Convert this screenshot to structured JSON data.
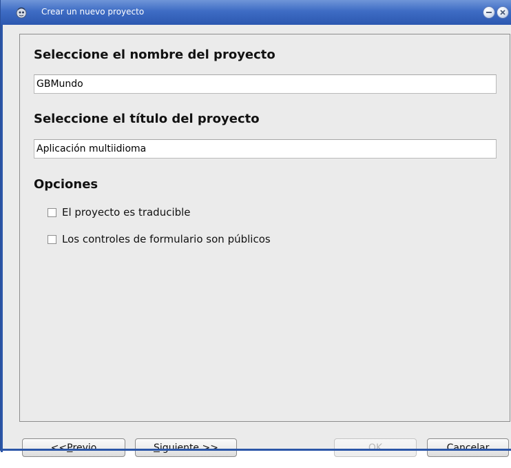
{
  "window": {
    "title": "Crear un nuevo proyecto",
    "icon": "gambas-app-icon",
    "controls": [
      "minimize-icon",
      "close-icon"
    ]
  },
  "form": {
    "name_heading": "Seleccione el nombre del proyecto",
    "name_value": "GBMundo",
    "title_heading": "Seleccione el título del proyecto",
    "title_value": "Aplicación multiidioma",
    "options_heading": "Opciones",
    "options": [
      {
        "label": "El proyecto es traducible",
        "checked": false
      },
      {
        "label": "Los controles de formulario son públicos",
        "checked": false
      }
    ]
  },
  "buttons": {
    "prev_pre": "<< ",
    "prev_mnemonic": "P",
    "prev_post": "revio",
    "next_mnemonic": "S",
    "next_post": "iguiente >>",
    "ok": "OK",
    "ok_enabled": false,
    "cancel": "Cancelar"
  },
  "colors": {
    "titlebar": "#3e6cc4",
    "dialog_bg": "#ebebeb",
    "disabled_text": "#b8b8b8"
  }
}
